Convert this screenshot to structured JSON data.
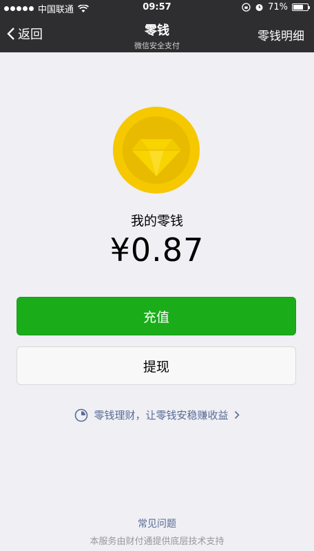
{
  "status_bar": {
    "carrier": "中国联通",
    "time": "09:57",
    "battery": "71%",
    "battery_level": 0.71
  },
  "nav": {
    "back_label": "返回",
    "title": "零钱",
    "subtitle": "微信安全支付",
    "detail_label": "零钱明细"
  },
  "wallet": {
    "coin_icon": "diamond-coin-icon",
    "balance_label": "我的零钱",
    "balance_amount": "¥0.87"
  },
  "actions": {
    "recharge_label": "充值",
    "withdraw_label": "提现"
  },
  "promo": {
    "text": "零钱理财，让零钱安稳赚收益"
  },
  "footer": {
    "faq_label": "常见问题",
    "support_text": "本服务由财付通提供底层技术支持"
  },
  "colors": {
    "nav_bg": "#2e2e30",
    "page_bg": "#efeff4",
    "primary_green": "#1aad19",
    "link_blue": "#576b95",
    "coin_gold": "#f5c800"
  }
}
